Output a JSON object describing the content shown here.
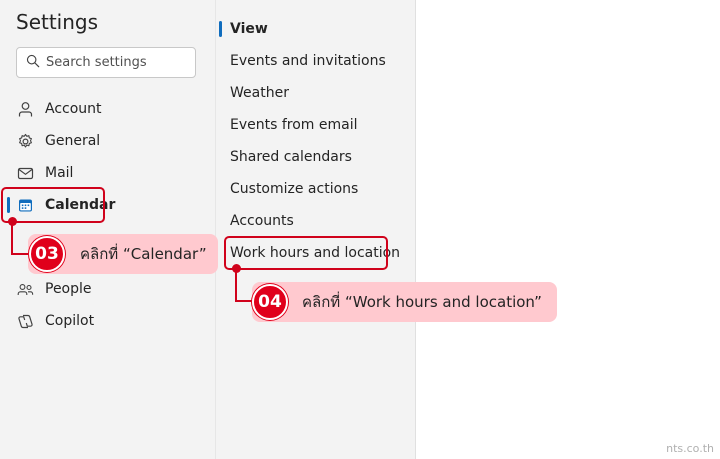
{
  "settings": {
    "title": "Settings",
    "search_placeholder": "Search settings"
  },
  "nav": {
    "items": [
      {
        "label": "Account",
        "icon": "person-icon"
      },
      {
        "label": "General",
        "icon": "gear-icon"
      },
      {
        "label": "Mail",
        "icon": "mail-icon"
      },
      {
        "label": "Calendar",
        "icon": "calendar-icon",
        "active": true
      },
      {
        "label": "People",
        "icon": "people-icon"
      },
      {
        "label": "Copilot",
        "icon": "copilot-icon"
      }
    ]
  },
  "subnav": {
    "items": [
      {
        "label": "View",
        "active": true
      },
      {
        "label": "Events and invitations"
      },
      {
        "label": "Weather"
      },
      {
        "label": "Events from email"
      },
      {
        "label": "Shared calendars"
      },
      {
        "label": "Customize actions"
      },
      {
        "label": "Accounts"
      },
      {
        "label": "Work hours and location",
        "highlighted": true
      }
    ]
  },
  "annotations": {
    "step3": {
      "number": "03",
      "text": "คลิกที่ “Calendar”"
    },
    "step4": {
      "number": "04",
      "text": "คลิกที่ “Work hours and location”"
    }
  },
  "watermark": "nts.co.th",
  "colors": {
    "accent": "#0f6cbd",
    "annotation_red": "#d0021b",
    "callout_bg": "#ffc9cf",
    "pane_bg": "#f3f3f3"
  }
}
